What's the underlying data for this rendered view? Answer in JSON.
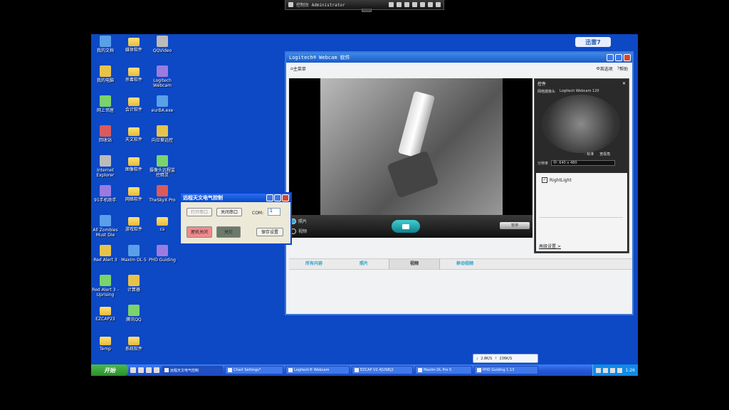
{
  "remote_bar": {
    "title": "控制台 Administrator"
  },
  "desktop": {
    "icons": [
      {
        "label": "我的文档",
        "icon": "my-documents-icon"
      },
      {
        "label": "我的电脑",
        "icon": "my-computer-icon"
      },
      {
        "label": "网上邻居",
        "icon": "network-places-icon"
      },
      {
        "label": "回收站",
        "icon": "recycle-bin-icon"
      },
      {
        "label": "Internet Explorer",
        "icon": "internet-explorer-icon"
      },
      {
        "label": "91手机助手",
        "icon": "phone-assistant-icon"
      },
      {
        "label": "All Zombies Must Die",
        "icon": "game-icon"
      },
      {
        "label": "Red Alert 3",
        "icon": "red-alert-icon"
      },
      {
        "label": "Red Alert 3 - Uprising",
        "icon": "red-alert-uprising-icon"
      },
      {
        "label": "EZCAP23",
        "icon": "folder-icon"
      },
      {
        "label": "Temp",
        "icon": "folder-icon"
      },
      {
        "label": "媒体软件",
        "icon": "folder-icon"
      },
      {
        "label": "杀毒软件",
        "icon": "folder-icon"
      },
      {
        "label": "会计软件",
        "icon": "folder-icon"
      },
      {
        "label": "天文软件",
        "icon": "folder-icon"
      },
      {
        "label": "图像软件",
        "icon": "folder-icon"
      },
      {
        "label": "网络软件",
        "icon": "folder-icon"
      },
      {
        "label": "游戏软件",
        "icon": "folder-icon"
      },
      {
        "label": "MaxIm DL 5",
        "icon": "maxim-dl-icon"
      },
      {
        "label": "计算器",
        "icon": "calculator-icon"
      },
      {
        "label": "腾讯QQ",
        "icon": "qq-icon"
      },
      {
        "label": "系统软件",
        "icon": "folder-icon"
      },
      {
        "label": "QQVideo",
        "icon": "qqvideo-icon"
      },
      {
        "label": "Logitech Webcam",
        "icon": "webcam-icon"
      },
      {
        "label": "eurBA.exe",
        "icon": "exe-icon"
      },
      {
        "label": "向日葵远控",
        "icon": "sunflower-icon"
      },
      {
        "label": "摄像头远程监控精灵",
        "icon": "camera-monitor-icon"
      },
      {
        "label": "TheSkyX Pro",
        "icon": "theskyx-icon"
      },
      {
        "label": "cs",
        "icon": "folder-icon"
      },
      {
        "label": "PHD Guiding",
        "icon": "phd-guiding-icon"
      }
    ],
    "xunlei": "迅雷7"
  },
  "webcam_window": {
    "title": "Logitech® Webcam 软件",
    "menu_home": "主菜单",
    "menu_options": "首选项",
    "menu_help": "帮助",
    "mode_photo": "照片",
    "mode_video": "视频",
    "pause_label": "暂停",
    "panel": {
      "title": "控件",
      "camera_label": "网络摄像头",
      "camera_name": "Logitech Webcam 120",
      "zoom_label": "· 标准",
      "zoom_wide": "宽视角",
      "res_label": "分辨率",
      "res_value": "中: 640 x 480",
      "rightlight": "RightLight",
      "advanced": "高级设置 >"
    },
    "tabs": [
      "所有内容",
      "照片",
      "视频",
      "移动视频"
    ]
  },
  "control_dialog": {
    "title": "远程天文电气控制",
    "open_port": "打开串口",
    "close_port": "关闭串口",
    "com_label": "COM:",
    "com_value": "1",
    "roof_close": "屋机关闭",
    "off": "关灯",
    "save": "保存设置"
  },
  "taskbar": {
    "start": "开始",
    "items": [
      "远程天文电气控制",
      "Chart Settings*",
      "Logitech® Webcam",
      "EZCAP V2.4[USB]2",
      "MaxIm DL Pro 5",
      "PHD Guiding 1.13"
    ],
    "time": "1:26"
  },
  "netmon": {
    "down": "2.8K/S",
    "up": "236K/S"
  }
}
